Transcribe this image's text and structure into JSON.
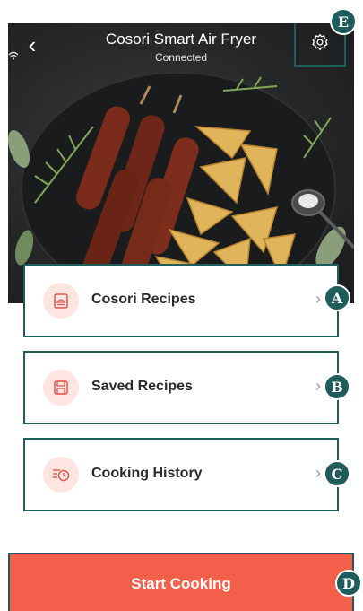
{
  "header": {
    "title": "Cosori Smart Air Fryer",
    "status": "Connected"
  },
  "menu": [
    {
      "label": "Cosori Recipes",
      "icon": "recipe-book-icon",
      "callout": "A"
    },
    {
      "label": "Saved Recipes",
      "icon": "save-icon",
      "callout": "B"
    },
    {
      "label": "Cooking History",
      "icon": "history-clock-icon",
      "callout": "C"
    }
  ],
  "start_button": {
    "label": "Start Cooking",
    "callout": "D"
  },
  "settings": {
    "callout": "E"
  },
  "colors": {
    "accent": "#f25f4a",
    "callout": "#1f5c5c",
    "icon_bg": "#fde6e2"
  }
}
